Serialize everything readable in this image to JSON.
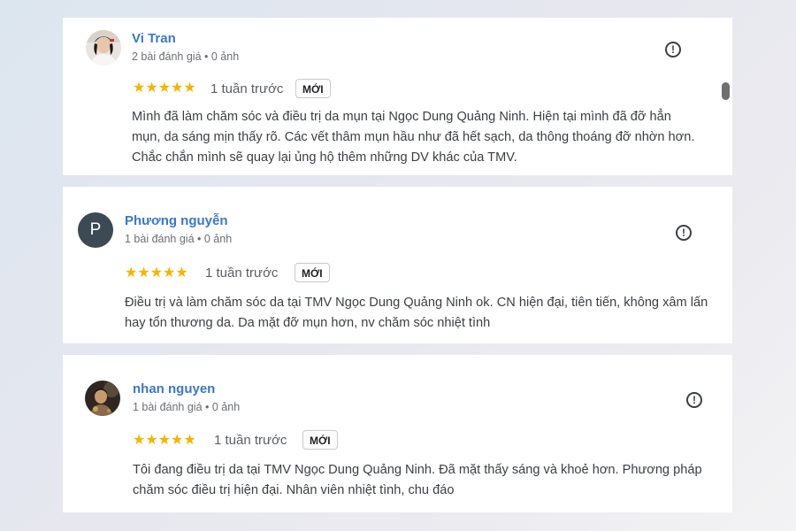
{
  "reviews": [
    {
      "name": "Vi Tran",
      "meta": "2 bài đánh giá • 0 ảnh",
      "stars": "★★★★★",
      "rating": 5,
      "time": "1 tuần trước",
      "badge": "MỚI",
      "text": "Mình đã làm chăm sóc và điều trị da mụn tại Ngọc Dung Quảng Ninh. Hiện tại mình đã đỡ hẳn mụn, da sáng mịn thấy rõ. Các vết thâm mụn hầu như đã hết sạch, da thông thoáng đỡ nhờn hơn. Chắc chắn mình sẽ quay lại ủng hộ thêm những DV khác của TMV."
    },
    {
      "name": "Phương nguyễn",
      "avatar_letter": "P",
      "meta": "1 bài đánh giá • 0 ảnh",
      "stars": "★★★★★",
      "rating": 5,
      "time": "1 tuần trước",
      "badge": "MỚI",
      "text": "Điều trị và làm chăm sóc da tại TMV Ngọc Dung Quảng Ninh ok. CN hiện đại, tiên tiến, không xâm lấn hay tổn thương da. Da mặt đỡ mụn hơn, nv chăm sóc nhiệt tình"
    },
    {
      "name": "nhan nguyen",
      "meta": "1 bài đánh giá • 0 ảnh",
      "stars": "★★★★★",
      "rating": 5,
      "time": "1 tuần trước",
      "badge": "MỚI",
      "text": "Tôi đang điều trị da tại TMV Ngọc Dung Quảng Ninh. Đã mặt thấy sáng và khoẻ hơn. Phương pháp chăm sóc điều trị hiện đại. Nhân viên nhiệt tình, chu đáo"
    }
  ],
  "report_icon_glyph": "!",
  "colors": {
    "name": "#3b78c6",
    "stars": "#f5b400",
    "avatar_letter_bg": "#3c4a55"
  }
}
